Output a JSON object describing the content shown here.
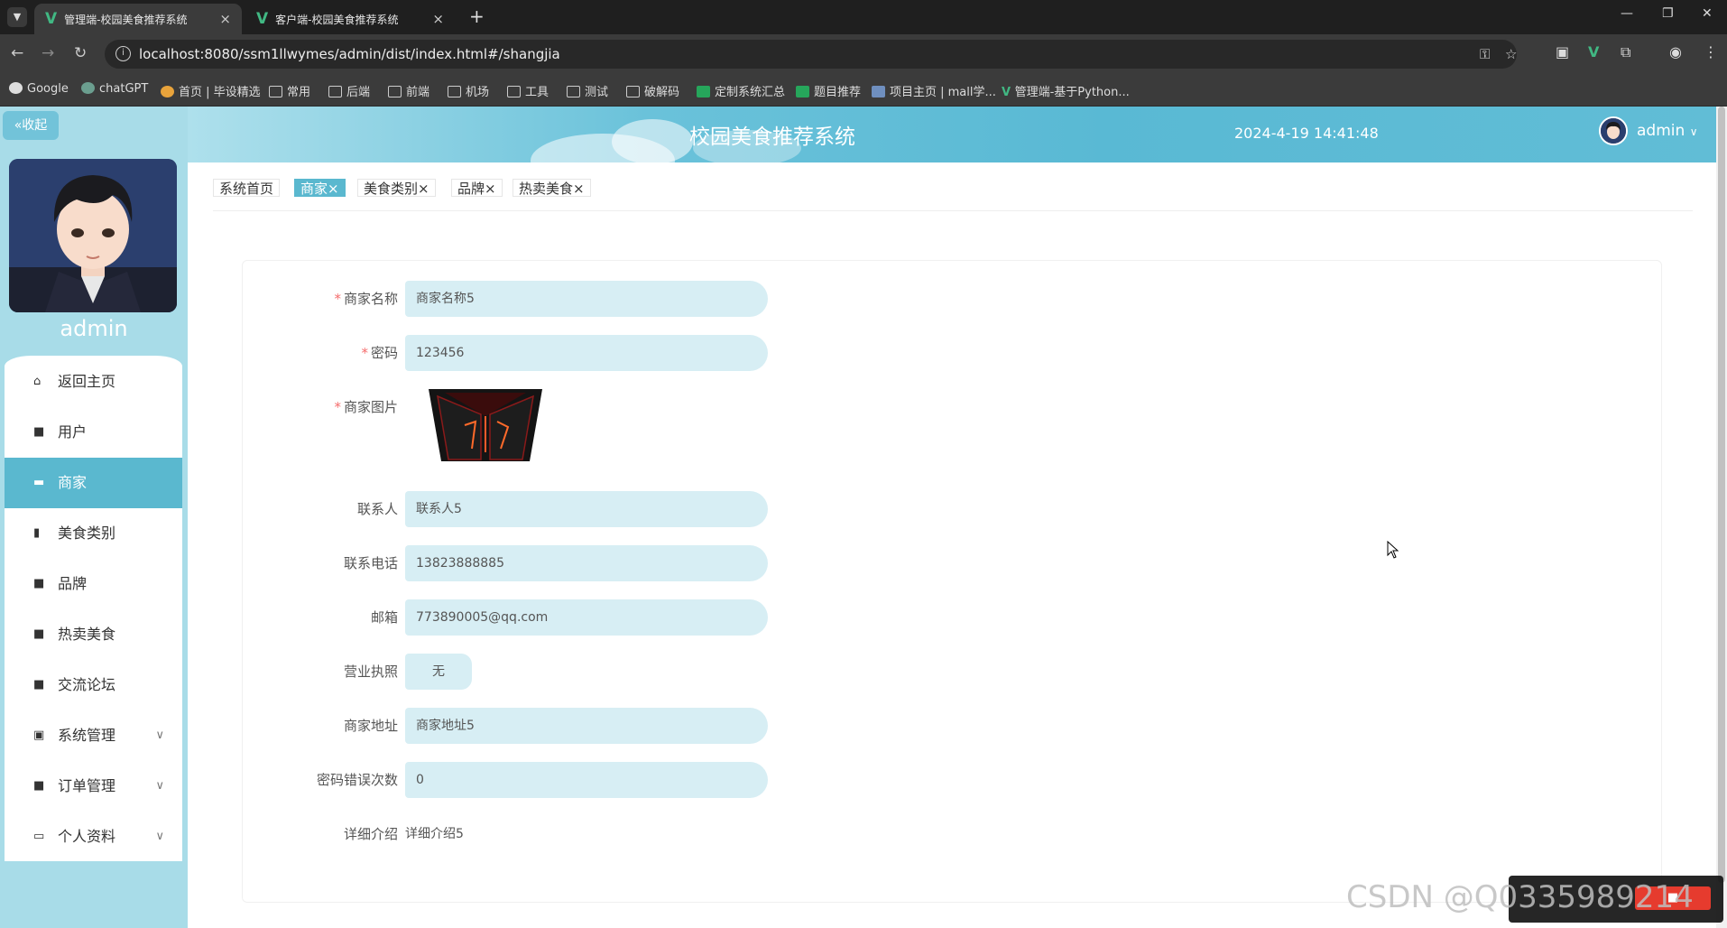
{
  "browser": {
    "tabs": [
      {
        "title": "管理端-校园美食推荐系统",
        "active": true
      },
      {
        "title": "客户端-校园美食推荐系统",
        "active": false
      }
    ],
    "url": "localhost:8080/ssm1llwymes/admin/dist/index.html#/shangjia",
    "bookmarks": [
      {
        "label": "Google",
        "icon": "google-icon"
      },
      {
        "label": "chatGPT",
        "icon": "chatgpt-icon"
      },
      {
        "label": "首页 | 毕设精选",
        "icon": "site-icon"
      },
      {
        "label": "常用",
        "icon": "folder-icon"
      },
      {
        "label": "后端",
        "icon": "folder-icon"
      },
      {
        "label": "前端",
        "icon": "folder-icon"
      },
      {
        "label": "机场",
        "icon": "folder-icon"
      },
      {
        "label": "工具",
        "icon": "folder-icon"
      },
      {
        "label": "测试",
        "icon": "folder-icon"
      },
      {
        "label": "破解码",
        "icon": "folder-icon"
      },
      {
        "label": "定制系统汇总",
        "icon": "sheet-icon"
      },
      {
        "label": "题目推荐",
        "icon": "sheet-icon"
      },
      {
        "label": "项目主页 | mall学...",
        "icon": "site-icon"
      },
      {
        "label": "管理端-基于Python...",
        "icon": "vue-icon"
      }
    ]
  },
  "sidebar": {
    "collapse_label": "收起",
    "username": "admin",
    "menu": [
      {
        "label": "返回主页",
        "icon": "home-icon",
        "active": false,
        "expandable": false
      },
      {
        "label": "用户",
        "icon": "grid-icon",
        "active": false,
        "expandable": false
      },
      {
        "label": "商家",
        "icon": "shop-icon",
        "active": true,
        "expandable": false
      },
      {
        "label": "美食类别",
        "icon": "clipboard-icon",
        "active": false,
        "expandable": false
      },
      {
        "label": "品牌",
        "icon": "grid-icon",
        "active": false,
        "expandable": false
      },
      {
        "label": "热卖美食",
        "icon": "grid-icon",
        "active": false,
        "expandable": false
      },
      {
        "label": "交流论坛",
        "icon": "grid-icon",
        "active": false,
        "expandable": false
      },
      {
        "label": "系统管理",
        "icon": "checklist-icon",
        "active": false,
        "expandable": true
      },
      {
        "label": "订单管理",
        "icon": "grid-icon",
        "active": false,
        "expandable": true
      },
      {
        "label": "个人资料",
        "icon": "card-icon",
        "active": false,
        "expandable": true
      }
    ]
  },
  "header": {
    "title": "校园美食推荐系统",
    "datetime": "2024-4-19 14:41:48",
    "user": "admin"
  },
  "tags": [
    {
      "label": "系统首页",
      "closable": false,
      "active": false
    },
    {
      "label": "商家",
      "closable": true,
      "active": true
    },
    {
      "label": "美食类别",
      "closable": true,
      "active": false
    },
    {
      "label": "品牌",
      "closable": true,
      "active": false
    },
    {
      "label": "热卖美食",
      "closable": true,
      "active": false
    }
  ],
  "form": {
    "shop_name": {
      "label": "商家名称",
      "required": true,
      "value": "商家名称5"
    },
    "password": {
      "label": "密码",
      "required": true,
      "value": "123456"
    },
    "shop_image": {
      "label": "商家图片",
      "required": true
    },
    "contact": {
      "label": "联系人",
      "required": false,
      "value": "联系人5"
    },
    "phone": {
      "label": "联系电话",
      "required": false,
      "value": "13823888885"
    },
    "email": {
      "label": "邮箱",
      "required": false,
      "value": "773890005@qq.com"
    },
    "license": {
      "label": "营业执照",
      "required": false,
      "value": "无"
    },
    "address": {
      "label": "商家地址",
      "required": false,
      "value": "商家地址5"
    },
    "pwd_errors": {
      "label": "密码错误次数",
      "required": false,
      "value": "0"
    },
    "detail": {
      "label": "详细介绍",
      "required": false,
      "value": "详细介绍5"
    }
  },
  "watermark": "CSDN @Q0335989214"
}
